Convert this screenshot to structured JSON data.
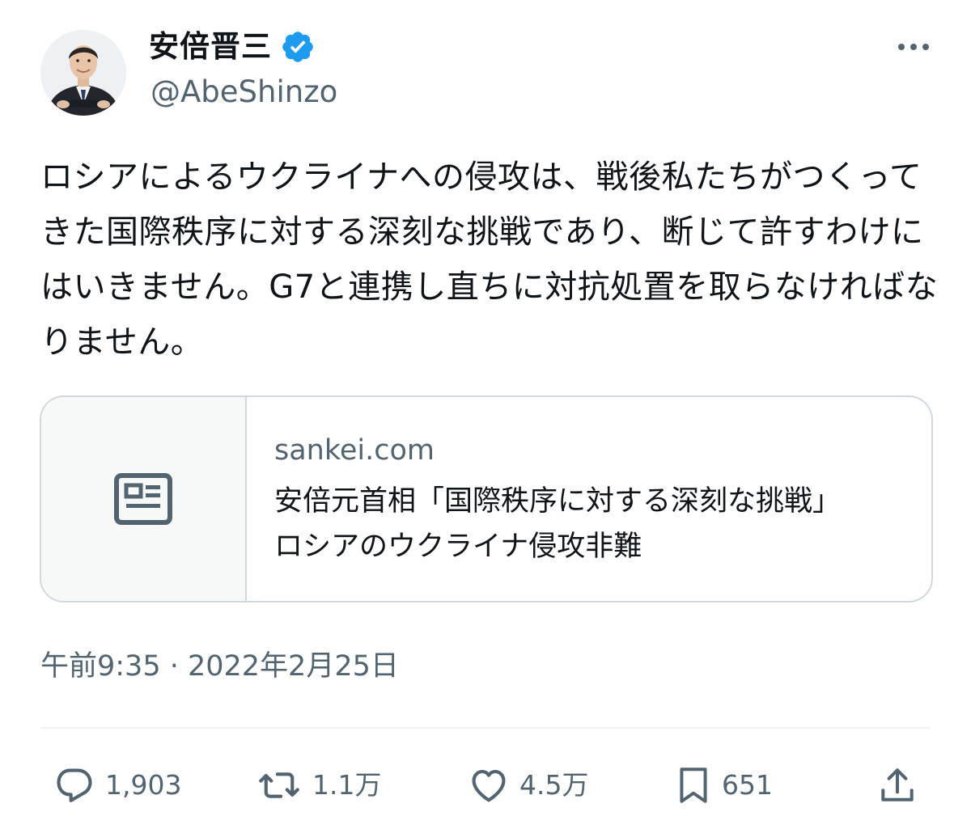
{
  "author": {
    "display_name": "安倍晋三",
    "handle": "@AbeShinzo",
    "verified": true,
    "verified_color": "#1d9bf0"
  },
  "tweet": {
    "text": "ロシアによるウクライナへの侵攻は、戦後私たちがつくってきた国際秩序に対する深刻な挑戦であり、断じて許すわけにはいきません。G7と連携し直ちに対抗処置を取らなければなりません。",
    "timestamp": "午前9:35 · 2022年2月25日"
  },
  "link_card": {
    "domain": "sankei.com",
    "title": "安倍元首相「国際秩序に対する深刻な挑戦」　ロシアのウクライナ侵攻非難",
    "thumbnail_icon": "article-icon"
  },
  "actions": {
    "replies": "1,903",
    "retweets": "1.1万",
    "likes": "4.5万",
    "bookmarks": "651"
  },
  "colors": {
    "text_primary": "#0f1419",
    "text_secondary": "#536471",
    "border": "#cfd9de",
    "accent": "#1d9bf0"
  }
}
